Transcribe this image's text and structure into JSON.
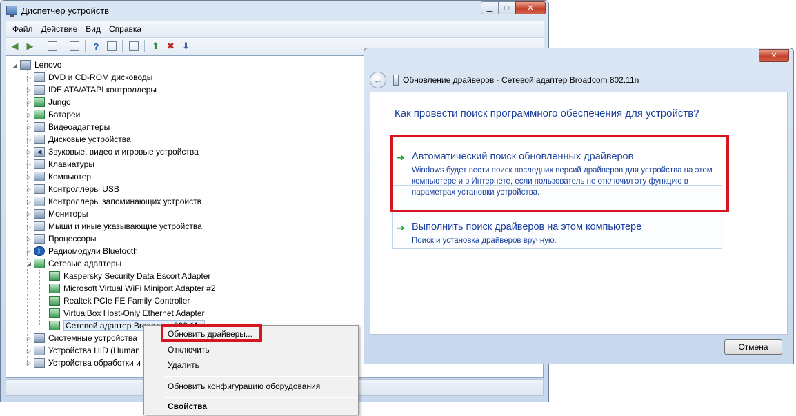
{
  "device_manager": {
    "title": "Диспетчер устройств",
    "menu": [
      "Файл",
      "Действие",
      "Вид",
      "Справка"
    ],
    "tree": {
      "root": "Lenovo",
      "categories": [
        "DVD и CD-ROM дисководы",
        "IDE ATA/ATAPI контроллеры",
        "Jungo",
        "Батареи",
        "Видеоадаптеры",
        "Дисковые устройства",
        "Звуковые, видео и игровые устройства",
        "Клавиатуры",
        "Компьютер",
        "Контроллеры USB",
        "Контроллеры запоминающих устройств",
        "Мониторы",
        "Мыши и иные указывающие устройства",
        "Процессоры",
        "Радиомодули Bluetooth",
        "Сетевые адаптеры"
      ],
      "network_adapters": [
        "Kaspersky Security Data Escort Adapter",
        "Microsoft Virtual WiFi Miniport Adapter #2",
        "Realtek PCIe FE Family Controller",
        "VirtualBox Host-Only Ethernet Adapter",
        "Сетевой адаптер Broadcom 802.11n"
      ],
      "after": [
        "Системные устройства",
        "Устройства HID (Human",
        "Устройства обработки и"
      ]
    }
  },
  "context_menu": {
    "items": [
      "Обновить драйверы...",
      "Отключить",
      "Удалить",
      "Обновить конфигурацию оборудования",
      "Свойства"
    ]
  },
  "update_dialog": {
    "title": "Обновление драйверов - Сетевой адаптер Broadcom 802.11n",
    "question": "Как провести поиск программного обеспечения для устройств?",
    "option_auto": {
      "title": "Автоматический поиск обновленных драйверов",
      "description": "Windows будет вести поиск последних версий драйверов для устройства на этом компьютере и в Интернете, если пользователь не отключил эту функцию в параметрах установки устройства."
    },
    "option_manual": {
      "title": "Выполнить поиск драйверов на этом компьютере",
      "description": "Поиск и установка драйверов вручную."
    },
    "cancel_label": "Отмена"
  },
  "colors": {
    "highlight": "#d6161f",
    "link_blue": "#1a3f9c",
    "arrow_green": "#23a233"
  }
}
